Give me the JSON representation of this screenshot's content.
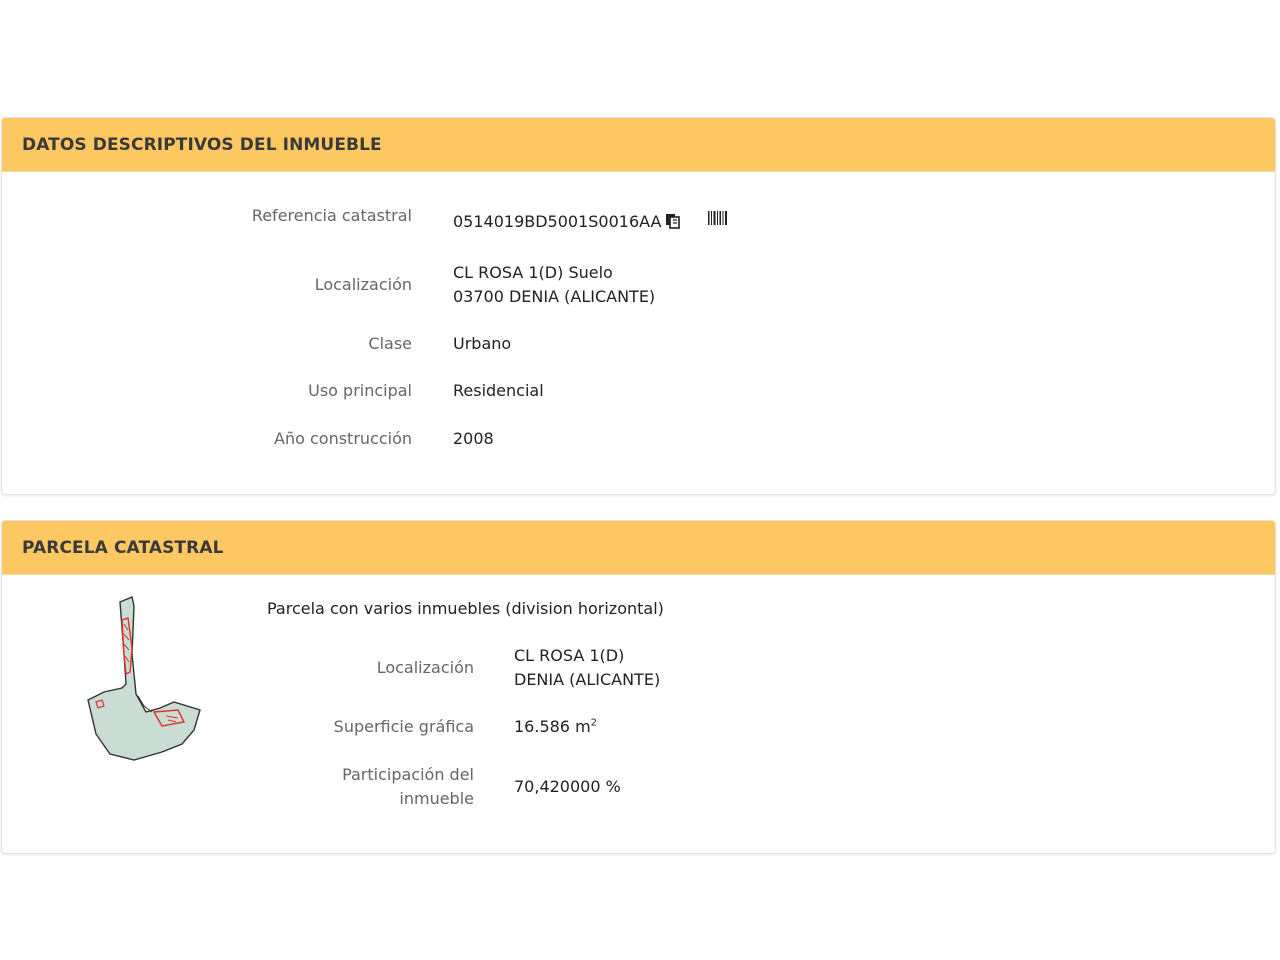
{
  "descriptivos": {
    "title": "DATOS DESCRIPTIVOS DEL INMUEBLE",
    "referencia_label": "Referencia catastral",
    "referencia_value": "0514019BD5001S0016AA",
    "copy_icon": "copy-icon",
    "barcode_icon": "barcode-icon",
    "localizacion_label": "Localización",
    "localizacion_line1": "CL ROSA 1(D) Suelo",
    "localizacion_line2": "03700 DENIA (ALICANTE)",
    "clase_label": "Clase",
    "clase_value": "Urbano",
    "uso_label": "Uso principal",
    "uso_value": "Residencial",
    "anio_label": "Año construcción",
    "anio_value": "2008"
  },
  "parcela": {
    "title": "PARCELA CATASTRAL",
    "description": "Parcela con varios inmuebles (division horizontal)",
    "localizacion_label": "Localización",
    "localizacion_line1": "CL ROSA 1(D)",
    "localizacion_line2": "DENIA (ALICANTE)",
    "superficie_label": "Superficie gráfica",
    "superficie_value": "16.586 m",
    "superficie_unit_sup": "2",
    "participacion_label_line1": "Participación del",
    "participacion_label_line2": "inmueble",
    "participacion_value": "70,420000 %",
    "colors": {
      "parcel_fill": "#c9ddd4",
      "parcel_stroke": "#333333",
      "building_stroke": "#e0312d"
    }
  }
}
